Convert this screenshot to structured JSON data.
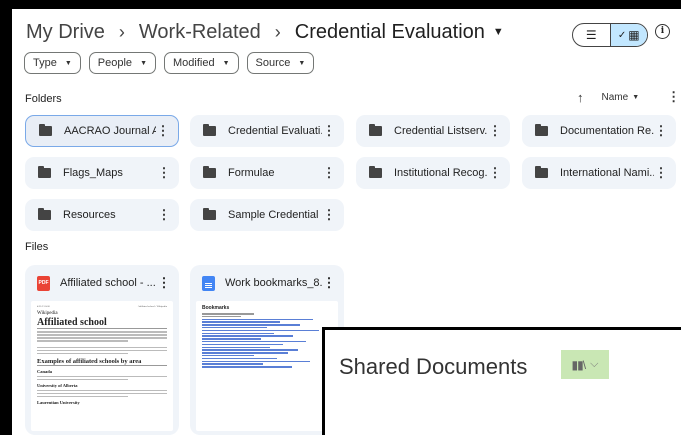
{
  "breadcrumb": {
    "items": [
      "My Drive",
      "Work-Related",
      "Credential Evaluation"
    ],
    "separator": "›"
  },
  "view_toggle": {
    "list_icon": "list-icon",
    "grid_icon": "grid-icon",
    "check_icon": "check-icon",
    "active": "grid"
  },
  "filters": [
    "Type",
    "People",
    "Modified",
    "Source"
  ],
  "sections": {
    "folders": "Folders",
    "files": "Files"
  },
  "sort": {
    "label": "Name"
  },
  "folders": [
    "AACRAO Journal A...",
    "Credential Evaluati...",
    "Credential Listserv...",
    "Documentation Re...",
    "Flags_Maps",
    "Formulae",
    "Institutional Recog...",
    "International Nami...",
    "Resources",
    "Sample Credential ..."
  ],
  "files": [
    {
      "name": "Affiliated school - ...",
      "type": "PDF",
      "preview": {
        "header_left": "4/21/13 8:00",
        "header_right": "Affiliated school - Wikipedia",
        "logo": "Wikipedia",
        "title": "Affiliated school",
        "section": "Examples of affiliated schools by area",
        "subsections": [
          "Canada",
          "University of Alberta",
          "Laurentian University"
        ]
      }
    },
    {
      "name": "Work bookmarks_8...",
      "type": "doc",
      "preview": {
        "title": "Bookmarks"
      }
    }
  ],
  "popup": {
    "title": "Shared Documents",
    "icon": "books-icon"
  },
  "colors": {
    "accent": "#c2e7ff",
    "card_bg": "#f0f4f9",
    "pdf_red": "#ea4335",
    "doc_blue": "#4285f4",
    "popup_button": "#c9e7b4"
  }
}
